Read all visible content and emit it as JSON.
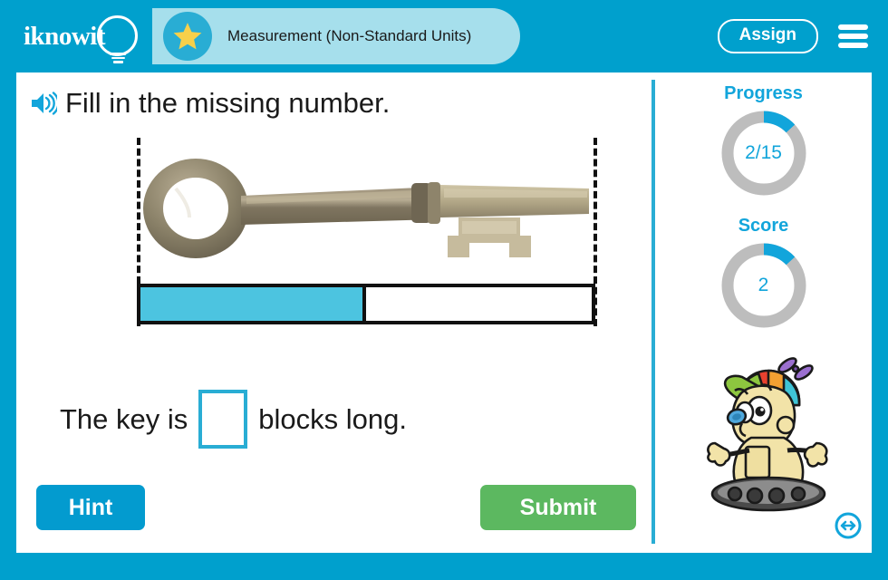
{
  "brand": {
    "logo_text": "iknowit",
    "logo_icon": "lightbulb-icon"
  },
  "header": {
    "badge_icon": "star-icon",
    "quiz_title": "Measurement (Non-Standard Units)",
    "assign_label": "Assign",
    "menu_icon": "hamburger-menu-icon"
  },
  "question": {
    "audio_icon": "speaker-icon",
    "prompt": "Fill in the missing number."
  },
  "activity": {
    "object_icon": "antique-key-image",
    "blocks_total": 2,
    "blocks_filled": 1,
    "sentence_before": "The key is",
    "sentence_after": "blocks long.",
    "answer_value": "",
    "answer_placeholder": ""
  },
  "actions": {
    "hint_label": "Hint",
    "submit_label": "Submit",
    "next_icon": "left-right-arrow-icon"
  },
  "sidebar": {
    "progress": {
      "label": "Progress",
      "value_text": "2/15",
      "current": 2,
      "total": 15,
      "percent": 13
    },
    "score": {
      "label": "Score",
      "value_text": "2",
      "current": 2,
      "percent": 13
    },
    "mascot_icon": "robot-mascot-icon"
  },
  "colors": {
    "brand_cyan": "#00A0CD",
    "light_cyan": "#A6DFEC",
    "accent_cyan": "#29ADD4",
    "block_fill": "#4CC4E0",
    "ring_track": "#BDBDBD",
    "ring_fill": "#12A5DB",
    "submit_green": "#5CB860",
    "hint_blue": "#039BCF",
    "star_yellow": "#F7D04A"
  }
}
